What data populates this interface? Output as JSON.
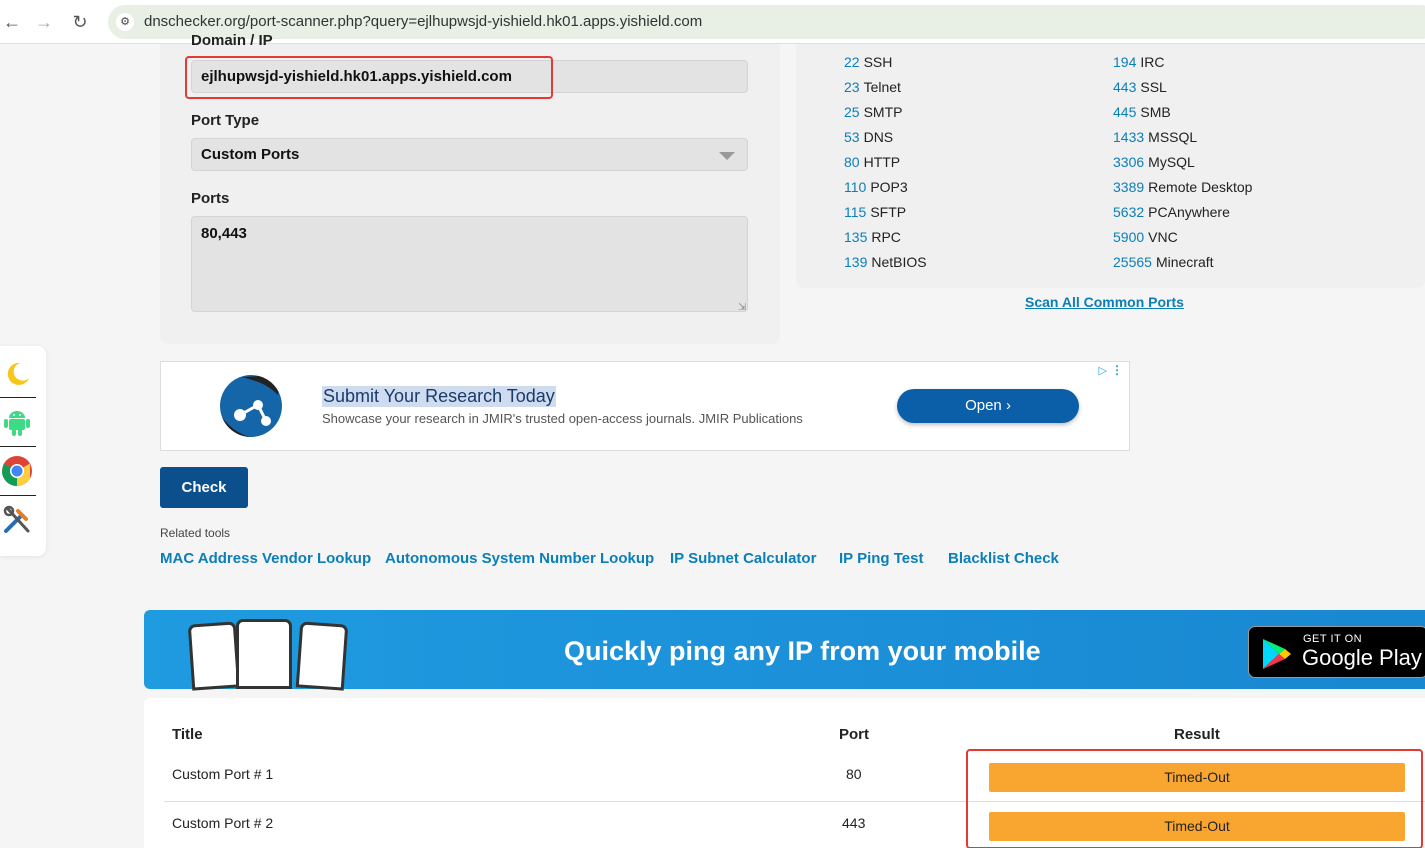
{
  "browser": {
    "url": "dnschecker.org/port-scanner.php?query=ejlhupwsjd-yishield.hk01.apps.yishield.com"
  },
  "form": {
    "domain_label": "Domain / IP",
    "domain_value": "ejlhupwsjd-yishield.hk01.apps.yishield.com",
    "port_type_label": "Port Type",
    "port_type_value": "Custom Ports",
    "ports_label": "Ports",
    "ports_value": "80,443"
  },
  "common_ports": {
    "left": [
      {
        "port": "22",
        "name": "SSH"
      },
      {
        "port": "23",
        "name": "Telnet"
      },
      {
        "port": "25",
        "name": "SMTP"
      },
      {
        "port": "53",
        "name": "DNS"
      },
      {
        "port": "80",
        "name": "HTTP"
      },
      {
        "port": "110",
        "name": "POP3"
      },
      {
        "port": "115",
        "name": "SFTP"
      },
      {
        "port": "135",
        "name": "RPC"
      },
      {
        "port": "139",
        "name": "NetBIOS"
      }
    ],
    "right": [
      {
        "port": "194",
        "name": "IRC"
      },
      {
        "port": "443",
        "name": "SSL"
      },
      {
        "port": "445",
        "name": "SMB"
      },
      {
        "port": "1433",
        "name": "MSSQL"
      },
      {
        "port": "3306",
        "name": "MySQL"
      },
      {
        "port": "3389",
        "name": "Remote Desktop"
      },
      {
        "port": "5632",
        "name": "PCAnywhere"
      },
      {
        "port": "5900",
        "name": "VNC"
      },
      {
        "port": "25565",
        "name": "Minecraft"
      }
    ],
    "scan_all_label": "Scan All Common Ports"
  },
  "side_tools": [
    "moon-icon",
    "android-icon",
    "chrome-icon",
    "tools-icon"
  ],
  "ad": {
    "title": "Submit Your Research Today",
    "description": "Showcase your research in JMIR's trusted open-access journals. JMIR Publications",
    "open_label": "Open"
  },
  "check_label": "Check",
  "related": {
    "label": "Related tools",
    "links": [
      "MAC Address Vendor Lookup",
      "Autonomous System Number Lookup",
      "IP Subnet Calculator",
      "IP Ping Test",
      "Blacklist Check"
    ]
  },
  "banner": {
    "text": "Quickly ping any IP from your mobile",
    "store_small": "GET IT ON",
    "store_big": "Google Play"
  },
  "results": {
    "headers": {
      "title": "Title",
      "port": "Port",
      "result": "Result"
    },
    "rows": [
      {
        "title": "Custom Port # 1",
        "port": "80",
        "result": "Timed-Out"
      },
      {
        "title": "Custom Port # 2",
        "port": "443",
        "result": "Timed-Out"
      }
    ]
  },
  "colors": {
    "link": "#0b7fb8",
    "check_button": "#0b4f8c",
    "timed_out": "#f9a630",
    "highlight": "#e53935"
  }
}
